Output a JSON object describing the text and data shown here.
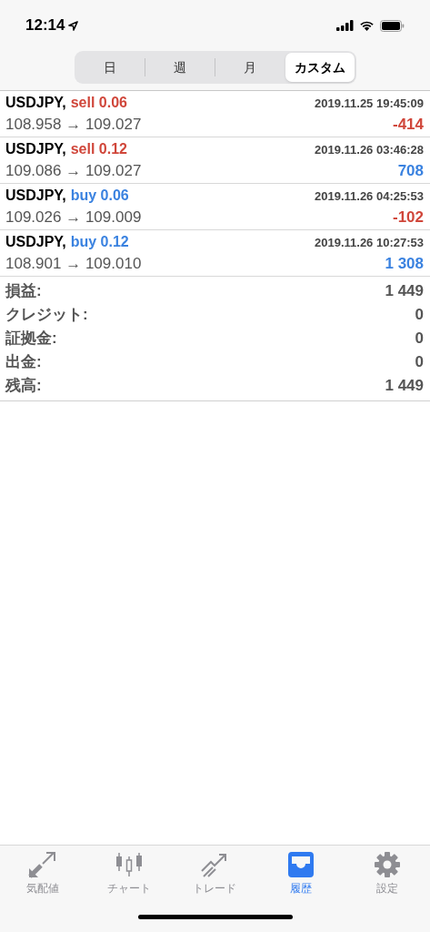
{
  "status_bar": {
    "time": "12:14"
  },
  "segments": [
    {
      "label": "日",
      "selected": false
    },
    {
      "label": "週",
      "selected": false
    },
    {
      "label": "月",
      "selected": false
    },
    {
      "label": "カスタム",
      "selected": true
    }
  ],
  "trades": [
    {
      "symbol": "USDJPY,",
      "order": {
        "text": "sell 0.06",
        "color": "#d0463a"
      },
      "time": "2019.11.25 19:45:09",
      "prices": "108.958 → 109.027",
      "profit": {
        "text": "-414",
        "color": "#d0463a"
      }
    },
    {
      "symbol": "USDJPY,",
      "order": {
        "text": "sell 0.12",
        "color": "#d0463a"
      },
      "time": "2019.11.26 03:46:28",
      "prices": "109.086 → 109.027",
      "profit": {
        "text": "708",
        "color": "#3a82e0"
      }
    },
    {
      "symbol": "USDJPY,",
      "order": {
        "text": "buy 0.06",
        "color": "#3a82e0"
      },
      "time": "2019.11.26 04:25:53",
      "prices": "109.026 → 109.009",
      "profit": {
        "text": "-102",
        "color": "#d0463a"
      }
    },
    {
      "symbol": "USDJPY,",
      "order": {
        "text": "buy 0.12",
        "color": "#3a82e0"
      },
      "time": "2019.11.26 10:27:53",
      "prices": "108.901 → 109.010",
      "profit": {
        "text": "1 308",
        "color": "#3a82e0"
      }
    }
  ],
  "summary": [
    {
      "label": "損益:",
      "value": "1 449"
    },
    {
      "label": "クレジット:",
      "value": "0"
    },
    {
      "label": "証拠金:",
      "value": "0"
    },
    {
      "label": "出金:",
      "value": "0"
    },
    {
      "label": "残高:",
      "value": "1 449"
    }
  ],
  "tab_bar": [
    {
      "label": "気配値",
      "kind": "quotes",
      "selected": false
    },
    {
      "label": "チャート",
      "kind": "chart",
      "selected": false
    },
    {
      "label": "トレード",
      "kind": "trade",
      "selected": false
    },
    {
      "label": "履歴",
      "kind": "history",
      "selected": true
    },
    {
      "label": "設定",
      "kind": "settings",
      "selected": false
    }
  ]
}
